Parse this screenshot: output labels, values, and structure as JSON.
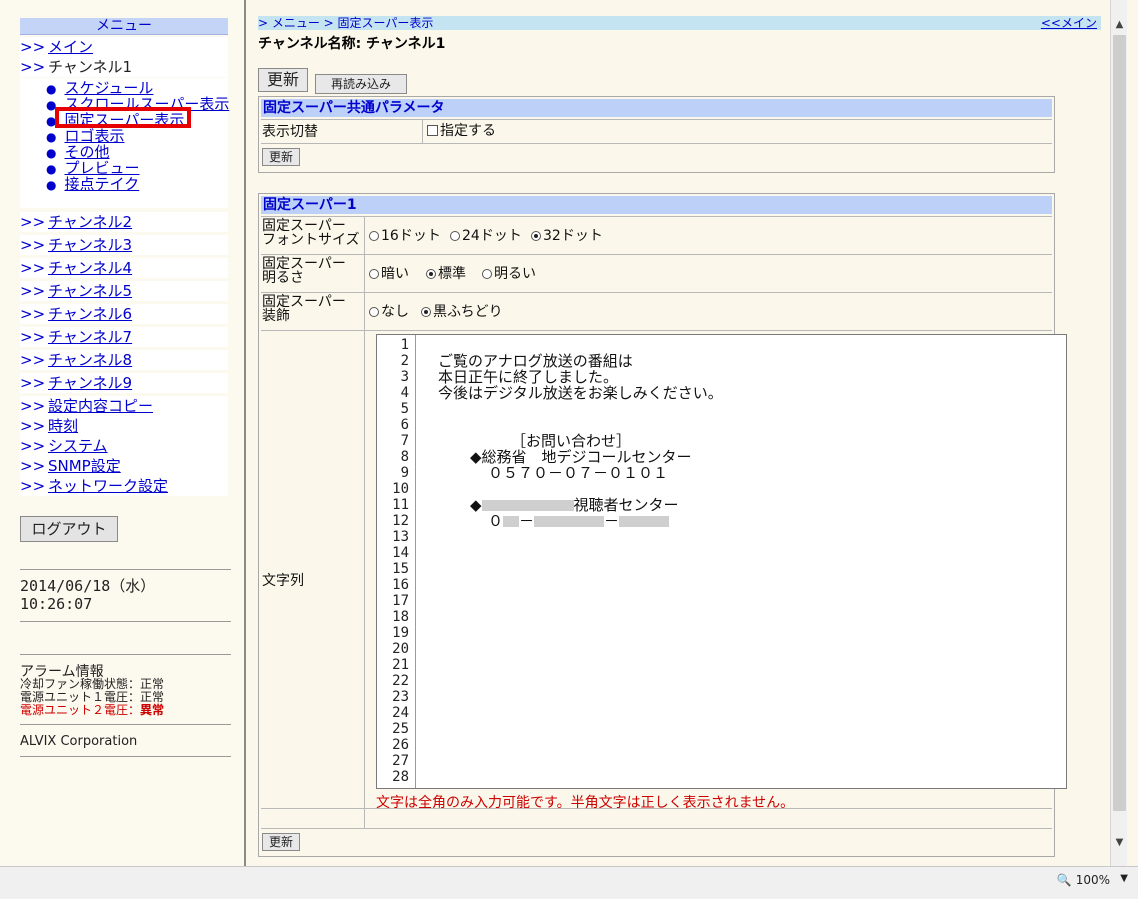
{
  "sidebar": {
    "menu_title": "メニュー",
    "arrow": ">>",
    "main_link": "メイン",
    "channel1": "チャンネル1",
    "channel1_items": [
      "スケジュール",
      "スクロールスーパー表示",
      "固定スーパー表示",
      "ロゴ表示",
      "その他",
      "プレビュー",
      "接点テイク"
    ],
    "channels": [
      "チャンネル2",
      "チャンネル3",
      "チャンネル4",
      "チャンネル5",
      "チャンネル6",
      "チャンネル7",
      "チャンネル8",
      "チャンネル9"
    ],
    "links": [
      "設定内容コピー",
      "時刻",
      "システム",
      "SNMP設定",
      "ネットワーク設定"
    ],
    "logout": "ログアウト",
    "date": "2014/06/18（水）",
    "time": "10:26:07",
    "alarm": {
      "title": "アラーム情報",
      "fan": "冷却ファン稼働状態：正常",
      "psu1": "電源ユニット１電圧：正常",
      "psu2_label": "電源ユニット２電圧：",
      "psu2_status": "異常"
    },
    "company": "ALVIX Corporation"
  },
  "main": {
    "breadcrumb": "> メニュー > 固定スーパー表示",
    "back_link": "<<メイン",
    "channel_name": "チャンネル名称: チャンネル1",
    "update_button": "更新",
    "reload_button": "再読み込み",
    "common_params": {
      "title": "固定スーパー共通パラメータ",
      "display_label": "表示切替",
      "checkbox_label": "指定する",
      "update_button": "更新"
    },
    "super1": {
      "title": "固定スーパー1",
      "font_label_1": "固定スーパー",
      "font_label_2": "フォントサイズ",
      "font_options": [
        "16ドット",
        "24ドット",
        "32ドット"
      ],
      "font_selected": "32ドット",
      "bright_label_1": "固定スーパー",
      "bright_label_2": "明るさ",
      "bright_options": [
        "暗い",
        "標準",
        "明るい"
      ],
      "bright_selected": "標準",
      "deco_label_1": "固定スーパー",
      "deco_label_2": "装飾",
      "deco_options": [
        "なし",
        "黒ふちどり"
      ],
      "deco_selected": "黒ふちどり",
      "text_label": "文字列",
      "line_numbers": [
        "1",
        "2",
        "3",
        "4",
        "5",
        "6",
        "7",
        "8",
        "9",
        "10",
        "11",
        "12",
        "13",
        "14",
        "15",
        "16",
        "17",
        "18",
        "19",
        "20",
        "21",
        "22",
        "23",
        "24",
        "25",
        "26",
        "27",
        "28"
      ],
      "text_lines": {
        "l2": "ご覧のアナログ放送の番組は",
        "l3": "本日正午に終了しました。",
        "l4": "今後はデジタル放送をお楽しみください。",
        "l7": "［お問い合わせ］",
        "l8": "◆総務省　地デジコールセンター",
        "l9": "０５７０－０７－０１０１",
        "l11_prefix": "◆",
        "l11_suffix": "視聴者センター",
        "l12_a": "０",
        "l12_dash1": "－",
        "l12_dash2": "－"
      },
      "warning": "文字は全角のみ入力可能です。半角文字は正しく表示されません。",
      "update_button": "更新"
    }
  },
  "statusbar": {
    "zoom": "100%"
  },
  "colors": {
    "background": "#fbf7ea",
    "header_blue": "#bcd0f8",
    "link": "#0000cc",
    "highlight": "#e60000",
    "alert": "#cc0000"
  }
}
